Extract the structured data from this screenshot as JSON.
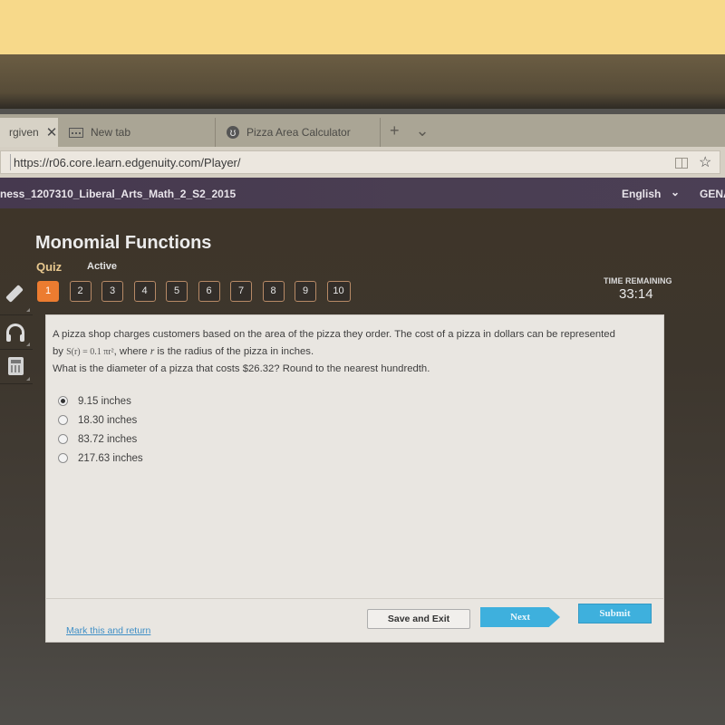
{
  "browser": {
    "tabs": [
      {
        "label": "rgiven",
        "active": true,
        "icon": "close-icon"
      },
      {
        "label": "New tab",
        "icon": "newtab-icon"
      },
      {
        "label": "Pizza Area Calculator",
        "icon": "globe-icon"
      }
    ],
    "tab_actions": {
      "new_tab": "+",
      "tab_list": "⌄"
    },
    "url": "https://r06.core.learn.edgenuity.com/Player/",
    "icons": [
      "reading-view-icon",
      "favorite-star-icon"
    ]
  },
  "course_bar": {
    "title": "ness_1207310_Liberal_Arts_Math_2_S2_2015",
    "language": "English",
    "user": "GENA"
  },
  "lesson": {
    "title": "Monomial Functions",
    "type": "Quiz",
    "status": "Active"
  },
  "question_nav": {
    "current": 1,
    "items": [
      "1",
      "2",
      "3",
      "4",
      "5",
      "6",
      "7",
      "8",
      "9",
      "10"
    ]
  },
  "timer": {
    "label": "TIME REMAINING",
    "value": "33:14"
  },
  "tools": [
    "pencil-icon",
    "headphones-icon",
    "calculator-icon"
  ],
  "question": {
    "line1": "A pizza shop charges customers based on the area of the pizza they order. The cost of a pizza in dollars can be represented",
    "by": "by",
    "formula": "S(r) = 0.1 πr²",
    "line2_a": ", where",
    "var": "r",
    "line2_b": "is the radius of the pizza in inches.",
    "line3": "What is the diameter of a pizza that costs $26.32? Round to the nearest hundredth."
  },
  "options": [
    {
      "label": "9.15 inches",
      "selected": true
    },
    {
      "label": "18.30 inches",
      "selected": false
    },
    {
      "label": "83.72 inches",
      "selected": false
    },
    {
      "label": "217.63 inches",
      "selected": false
    }
  ],
  "footer": {
    "mark_link": "Mark this and return",
    "save_exit": "Save and Exit",
    "next": "Next",
    "submit": "Submit"
  }
}
